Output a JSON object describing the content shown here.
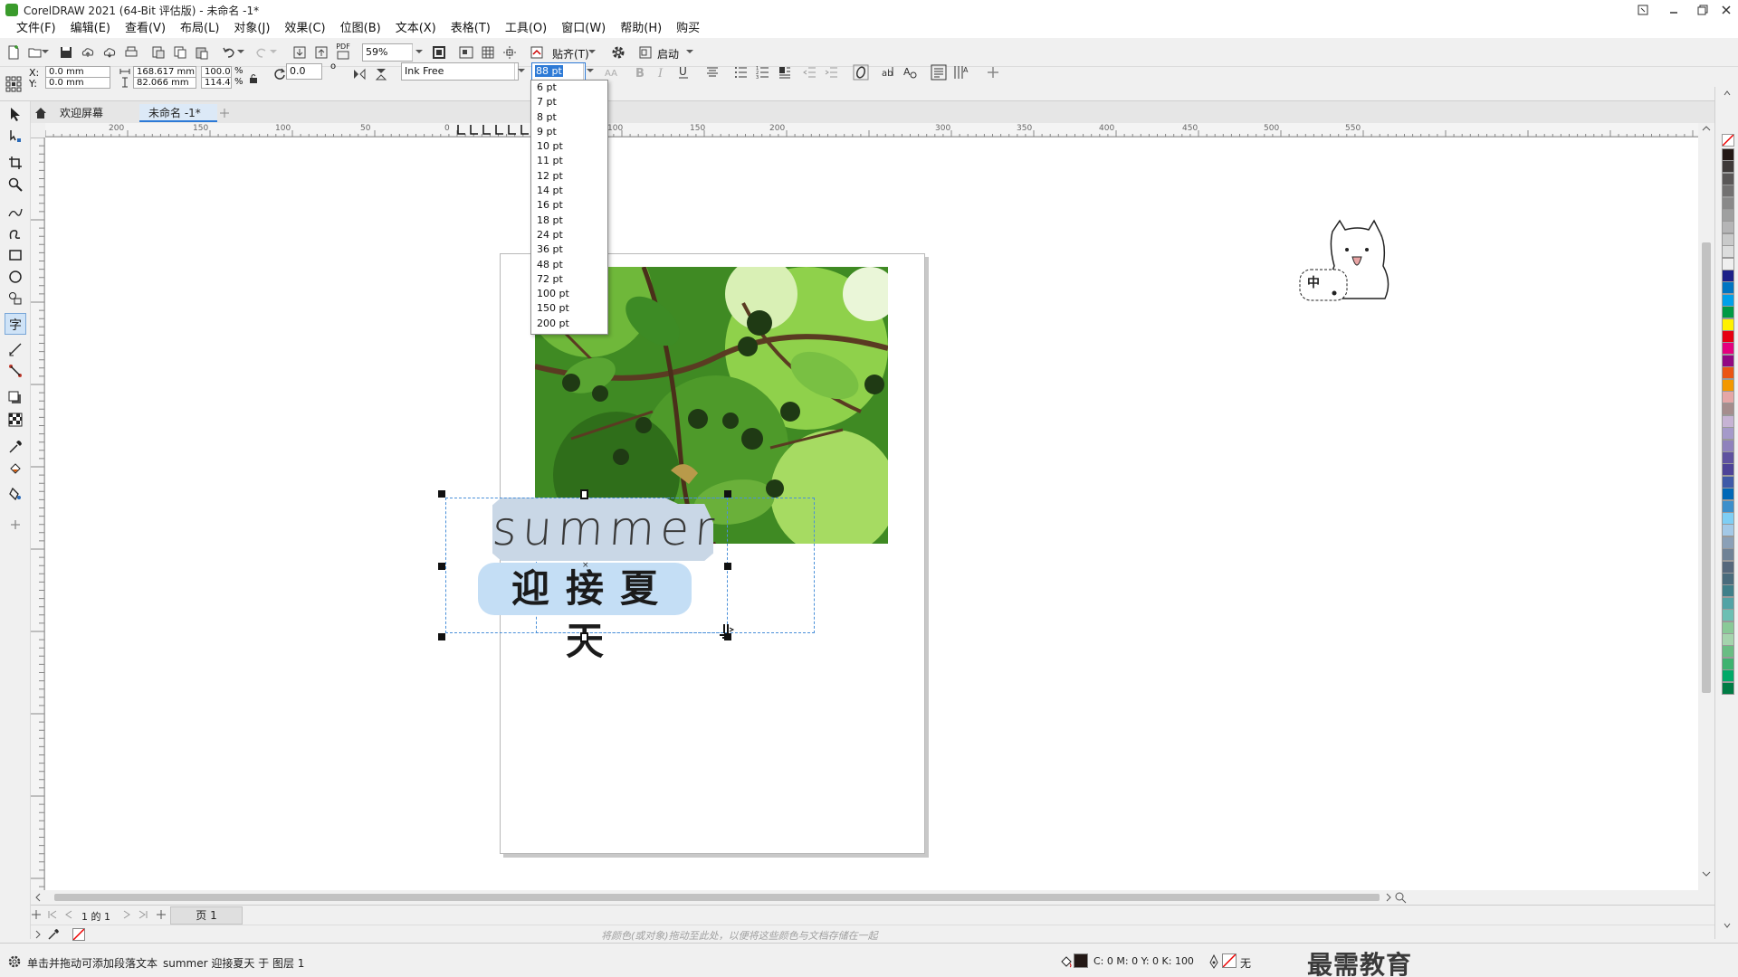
{
  "window": {
    "title": "CorelDRAW 2021 (64-Bit 评估版) - 未命名 -1*"
  },
  "menu": [
    "文件(F)",
    "编辑(E)",
    "查看(V)",
    "布局(L)",
    "对象(J)",
    "效果(C)",
    "位图(B)",
    "文本(X)",
    "表格(T)",
    "工具(O)",
    "窗口(W)",
    "帮助(H)",
    "购买"
  ],
  "std_toolbar": {
    "zoom_value": "59%",
    "snap_label": "贴齐(T)",
    "launch_label": "启动",
    "pdf_label": "PDF"
  },
  "prop_bar": {
    "x_label": "X:",
    "y_label": "Y:",
    "x_value": "0.0 mm",
    "y_value": "0.0 mm",
    "width_value": "168.617 mm",
    "height_value": "82.066 mm",
    "scale_x": "100.0",
    "scale_y": "114.4",
    "percent": "%",
    "rotation": "0.0",
    "degree": "o",
    "font_name": "Ink Free",
    "font_size": "88 pt"
  },
  "font_size_options": [
    "6 pt",
    "7 pt",
    "8 pt",
    "9 pt",
    "10 pt",
    "11 pt",
    "12 pt",
    "14 pt",
    "16 pt",
    "18 pt",
    "24 pt",
    "36 pt",
    "48 pt",
    "72 pt",
    "100 pt",
    "150 pt",
    "200 pt"
  ],
  "tabs": [
    "欢迎屏幕",
    "未命名 -1*"
  ],
  "ruler_h_labels": [
    "200",
    "150",
    "100",
    "50",
    "0",
    "50",
    "100",
    "150",
    "200",
    "250",
    "300",
    "350",
    "400",
    "450",
    "500",
    "550"
  ],
  "ruler_v_labels": [
    "0",
    "50",
    "100",
    "150",
    "200",
    "250",
    "300",
    "350",
    "400",
    "450",
    "500"
  ],
  "canvas_text": {
    "line1": "summer",
    "line2": "迎接夏天"
  },
  "pagebar": {
    "page_of": "1 的 1",
    "page_tab": "页 1"
  },
  "colorbar_hint": "将颜色(或对象)拖动至此处，以便将这些颜色与文档存储在一起",
  "status": {
    "hint": "单击并拖动可添加段落文本",
    "object_info": "summer 迎接夏天 于 图层 1",
    "cmyk": "C: 0 M: 0 Y: 0 K: 100",
    "outline": "无"
  },
  "sticker_text": "中",
  "watermark": "最需教育",
  "palette_colors": [
    "#231815",
    "#3e3a39",
    "#595757",
    "#727171",
    "#898989",
    "#9fa0a0",
    "#b5b5b6",
    "#c9caca",
    "#dcdddd",
    "#efefef",
    "#1d2088",
    "#0075c2",
    "#00a0e9",
    "#009944",
    "#fff100",
    "#e60012",
    "#e4007f",
    "#920783",
    "#ea5514",
    "#f39800",
    "#e5a6a6",
    "#a58d8d",
    "#c6b3d4",
    "#a59aca",
    "#8f82bc",
    "#5f52a0",
    "#4d4398",
    "#3e5aa8",
    "#0068b7",
    "#3c8fcb",
    "#7ecef4",
    "#a3c9e7",
    "#8aa0b7",
    "#6f8296",
    "#56687c",
    "#4a6b7c",
    "#3f7f89",
    "#52a3a5",
    "#6cbfb3",
    "#89c997",
    "#a5d4ad",
    "#69bd83",
    "#3eb370",
    "#00a968",
    "#007c45"
  ]
}
